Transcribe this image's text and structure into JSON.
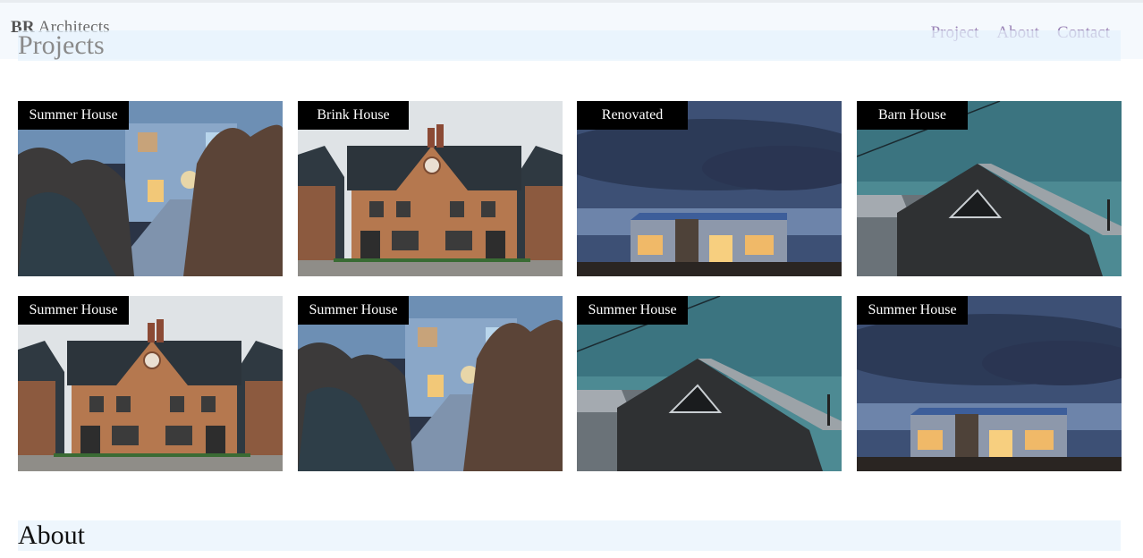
{
  "brand": {
    "bold": "BR",
    "rest": " Architects"
  },
  "nav": [
    "Project",
    "About",
    "Contact"
  ],
  "sections": {
    "projects": "Projects",
    "about": "About"
  },
  "projects": [
    {
      "title": "Summer House",
      "image": "walkway-house"
    },
    {
      "title": "Brink House",
      "image": "brick-house"
    },
    {
      "title": "Renovated",
      "image": "night-cabin"
    },
    {
      "title": "Barn House",
      "image": "barn-house"
    },
    {
      "title": "Summer House",
      "image": "brick-house"
    },
    {
      "title": "Summer House",
      "image": "walkway-house"
    },
    {
      "title": "Summer House",
      "image": "barn-house"
    },
    {
      "title": "Summer House",
      "image": "night-cabin"
    }
  ]
}
